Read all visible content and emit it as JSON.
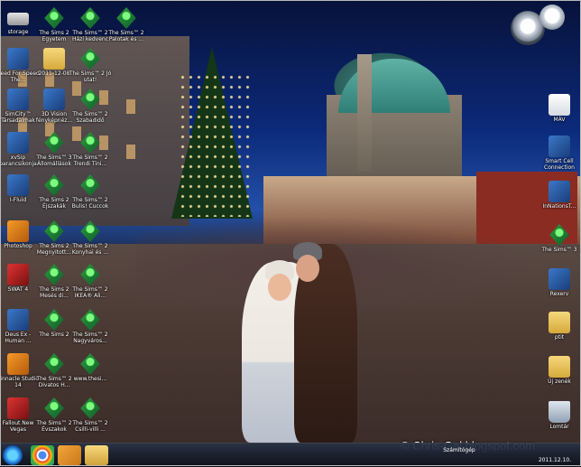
{
  "desktop_icons": [
    {
      "label": "storage",
      "icon": "drive-icon"
    },
    {
      "label": "Need For Speed The...",
      "icon": "game-icon"
    },
    {
      "label": "SimCity™ Társadalmak",
      "icon": "simcity-icon"
    },
    {
      "label": "xvSip parancsikonja",
      "icon": "sip-icon"
    },
    {
      "label": "I-Fluid",
      "icon": "fluid-icon"
    },
    {
      "label": "Photoshop",
      "icon": "photoshop-icon"
    },
    {
      "label": "SWAT 4",
      "icon": "swat-icon"
    },
    {
      "label": "Deus Ex - Human ...",
      "icon": "deus-ex-icon"
    },
    {
      "label": "Pinnacle Studio 14",
      "icon": "pinnacle-icon"
    },
    {
      "label": "Fallout New Vegas",
      "icon": "fallout-icon"
    },
    {
      "label": "The Sims 2 Egyetem",
      "icon": "sims-icon"
    },
    {
      "label": "2011-12-08",
      "icon": "folder-icon"
    },
    {
      "label": "3D Vision fényképnéz...",
      "icon": "3dvision-icon"
    },
    {
      "label": "The Sims™ 3 Állomállások",
      "icon": "sims-icon"
    },
    {
      "label": "The Sims 2 Éjszakák",
      "icon": "sims-icon"
    },
    {
      "label": "The Sims 2 Megnyitott...",
      "icon": "sims-icon"
    },
    {
      "label": "The Sims 2 Mesés di...",
      "icon": "sims-icon"
    },
    {
      "label": "The Sims 2",
      "icon": "sims-icon"
    },
    {
      "label": "The Sims™ 2 Divatos H...",
      "icon": "sims-icon"
    },
    {
      "label": "The Sims™ 2 Évszakok",
      "icon": "sims-icon"
    },
    {
      "label": "The Sims™ 2 Házi kedvenc",
      "icon": "sims-icon"
    },
    {
      "label": "The Sims™ 2 Jó utat!",
      "icon": "sims-icon"
    },
    {
      "label": "The Sims™ 2 Szabadidő",
      "icon": "sims-icon"
    },
    {
      "label": "The Sims™ 2 Trendi Tini...",
      "icon": "sims-icon"
    },
    {
      "label": "The Sims™ 2 Bulis! Cuccok",
      "icon": "sims-icon"
    },
    {
      "label": "The Sims™ 2 Konyhai és ...",
      "icon": "sims-icon"
    },
    {
      "label": "The Sims™ 2 IKEA® Ali...",
      "icon": "sims-icon"
    },
    {
      "label": "The Sims™ 2 Nagyváros...",
      "icon": "sims-icon"
    },
    {
      "label": "www.thesi...",
      "icon": "sims-icon"
    },
    {
      "label": "The Sims™ 2 Csilli-villi ...",
      "icon": "sims-icon"
    },
    {
      "label": "The Sims™ 2 Palotak és ...",
      "icon": "sims-icon"
    }
  ],
  "right_icons": [
    {
      "label": "MÁV",
      "icon": "document-icon"
    },
    {
      "label": "Smart Cell Connection",
      "icon": "smartcell-icon"
    },
    {
      "label": "InNationsT...",
      "icon": "app-icon"
    },
    {
      "label": "The Sims™ 3",
      "icon": "sims-icon"
    },
    {
      "label": "Rexerv",
      "icon": "app-icon"
    },
    {
      "label": "ptit",
      "icon": "folder-icon"
    },
    {
      "label": "Új zenék",
      "icon": "folder-icon"
    },
    {
      "label": "Lomtár",
      "icon": "recycle-bin-icon"
    }
  ],
  "taskbar": {
    "tray_label": "Számítógép",
    "clock_date": "2011.12.10."
  },
  "watermark": "© Chris-Gal.blogspot.com"
}
